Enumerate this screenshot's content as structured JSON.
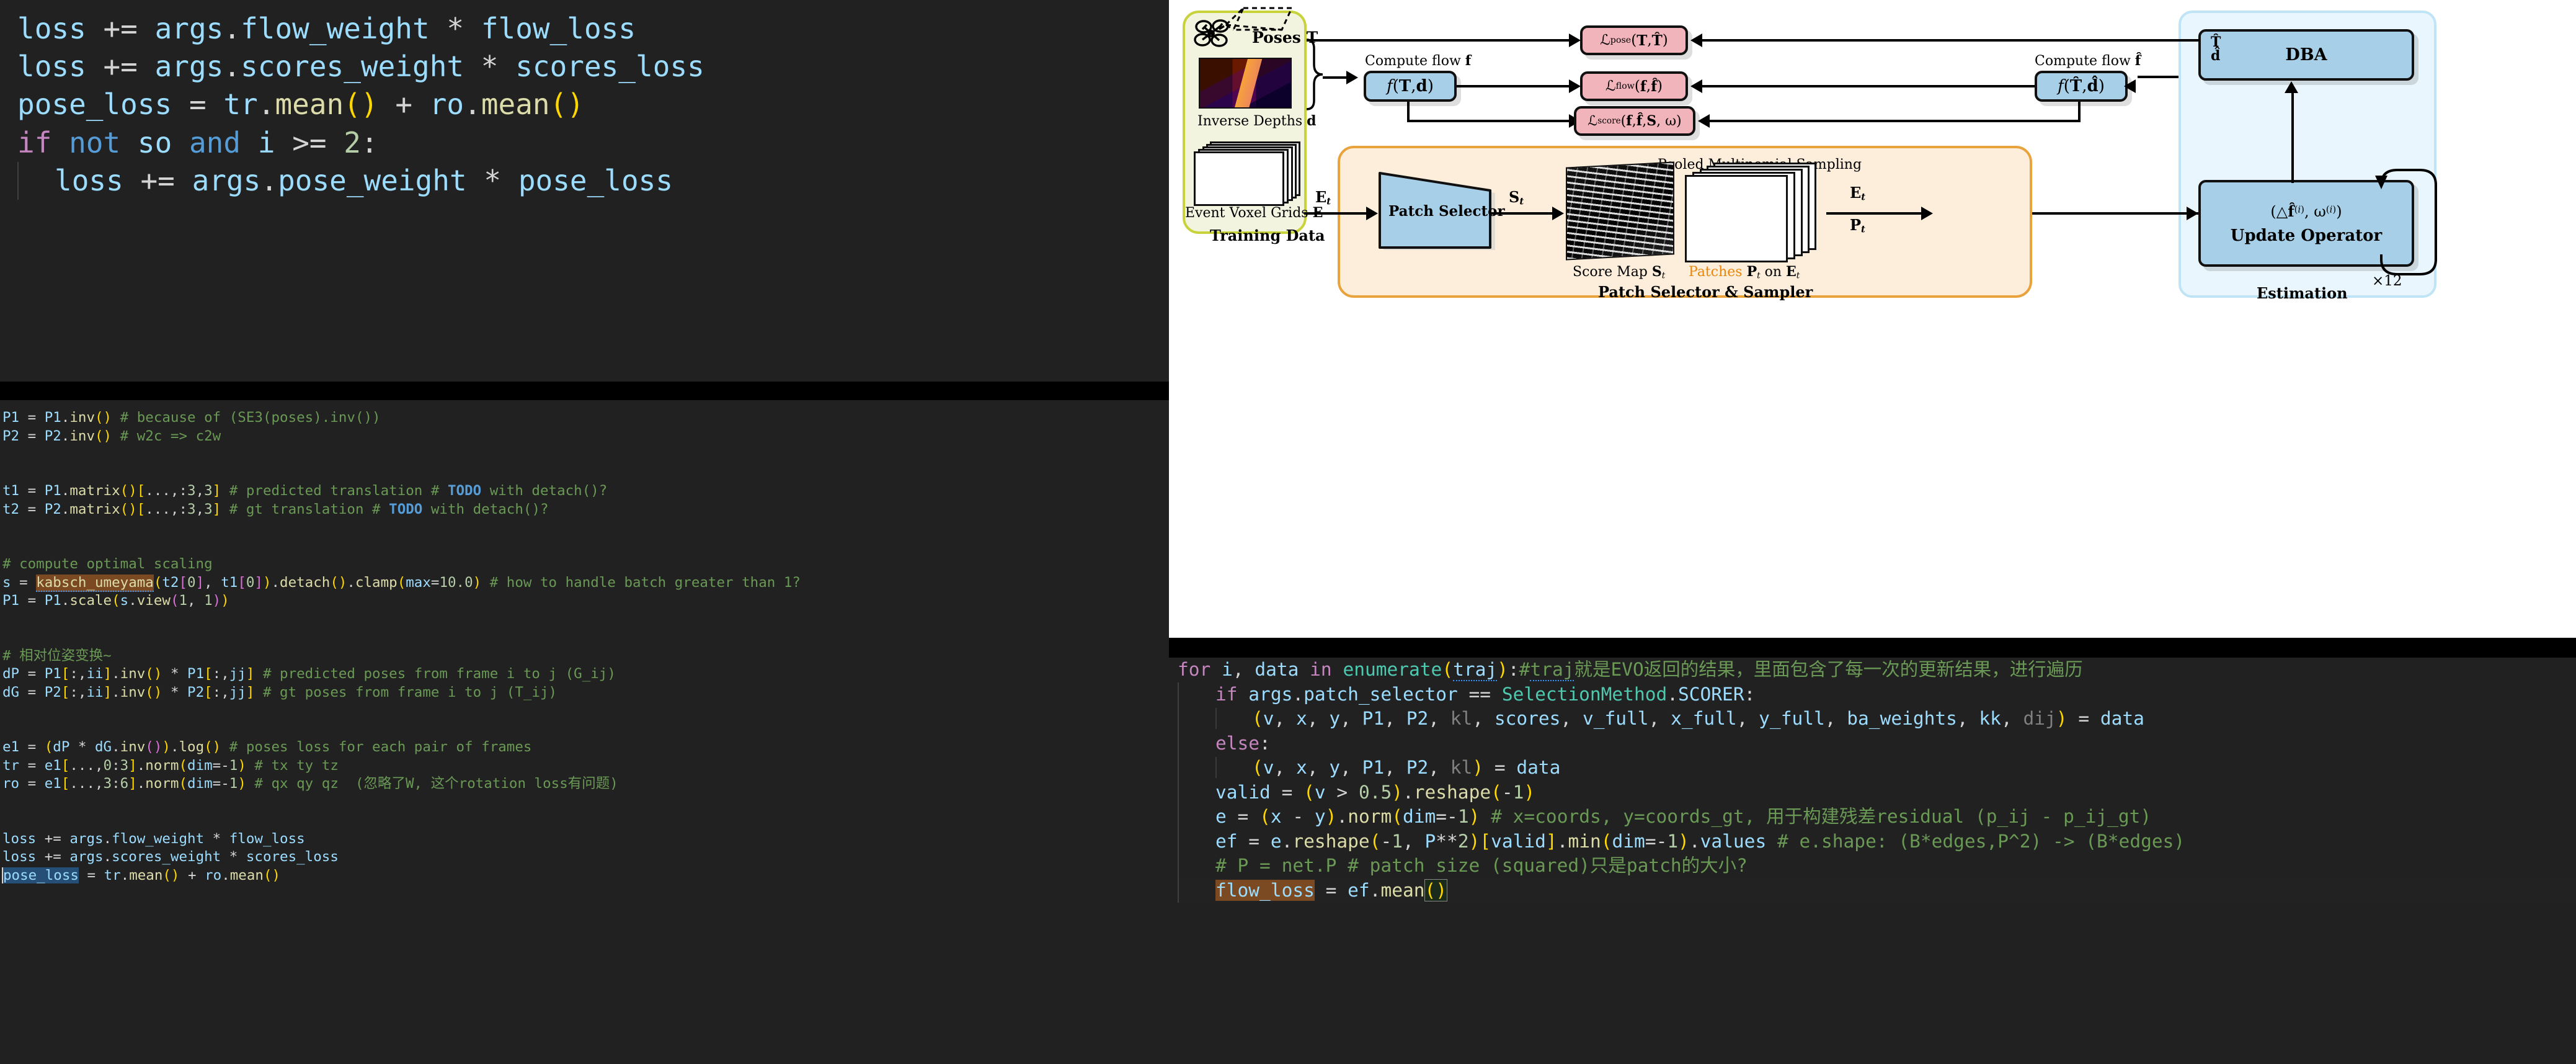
{
  "top_code_panel": {
    "name": "python-loss-snippet-large",
    "lines": [
      "loss += args.flow_weight * flow_loss",
      "loss += args.scores_weight * scores_loss",
      "pose_loss = tr.mean() + ro.mean()",
      "if not so and i >= 2:",
      "    loss += args.pose_weight * pose_loss"
    ]
  },
  "left_code_panel": {
    "name": "python-pose-loss-snippet",
    "lines": [
      "P1 = P1.inv() # because of (SE3(poses).inv())",
      "P2 = P2.inv() # w2c => c2w",
      "",
      "",
      "t1 = P1.matrix()[...,:3,3] # predicted translation # TODO with detach()?",
      "t2 = P2.matrix()[...,:3,3] # gt translation # TODO with detach()?",
      "",
      "",
      "# compute optimal scaling",
      "s = kabsch_umeyama(t2[0], t1[0]).detach().clamp(max=10.0) # how to handle batch greater than 1?",
      "P1 = P1.scale(s.view(1, 1))",
      "",
      "",
      "# 相对位姿变换~",
      "dP = P1[:,ii].inv() * P1[:,jj] # predicted poses from frame i to j (G_ij)",
      "dG = P2[:,ii].inv() * P2[:,jj] # gt poses from frame i to j (T_ij)",
      "",
      "",
      "e1 = (dP * dG.inv()).log() # poses loss for each pair of frames",
      "tr = e1[...,0:3].norm(dim=-1) # tx ty tz",
      "ro = e1[...,3:6].norm(dim=-1) # qx qy qz  (忽略了W, 这个rotation loss有问题)",
      "",
      "",
      "loss += args.flow_weight * flow_loss",
      "loss += args.scores_weight * scores_loss",
      "pose_loss = tr.mean() + ro.mean()"
    ],
    "highlighted_token": "kabsch_umeyama",
    "selected_token": "pose_loss"
  },
  "bottom_code_panel": {
    "name": "python-flow-loss-snippet",
    "lines": [
      "for i, data in enumerate(traj):#traj就是EVO返回的结果，里面包含了每一次的更新结果，进行遍历",
      "    if args.patch_selector == SelectionMethod.SCORER:",
      "        (v, x, y, P1, P2, kl, scores, v_full, x_full, y_full, ba_weights, kk, dij) = data",
      "    else:",
      "        (v, x, y, P1, P2, kl) = data",
      "    valid = (v > 0.5).reshape(-1)",
      "    e = (x - y).norm(dim=-1) # x=coords, y=coords_gt, 用于构建残差residual (p_ij - p_ij_gt)",
      "    ef = e.reshape(-1, P**2)[valid].min(dim=-1).values # e.shape: (B*edges,P^2) -> (B*edges)",
      "    # P = net.P # patch size (squared)只是patch的大小?",
      "    flow_loss = ef.mean()"
    ],
    "highlighted_token": "flow_loss"
  },
  "figure": {
    "groups": {
      "training_data": {
        "title": "Training Data",
        "border_color": "#c8d23a",
        "fill": "#f3f4e0"
      },
      "patch_selector": {
        "title": "Patch Selector & Sampler",
        "border_color": "#e8a33d",
        "fill": "#fdeedb"
      },
      "estimation": {
        "title": "Estimation",
        "border_color": "#bfe4f5",
        "fill": "#eaf6fd"
      }
    },
    "training_data": {
      "poses_label": "Poses T",
      "depth_caption": "Inverse Depths d",
      "events_caption": "Event Voxel Grids E",
      "drone_icon": "quadcopter-icon"
    },
    "compute_flow_gt": {
      "caption": "Compute flow f",
      "box": "f(T, d)"
    },
    "compute_flow_pred": {
      "caption": "Compute flow f̂",
      "box": "f(T̂, d̂)"
    },
    "losses": [
      {
        "name": "pose-loss",
        "label": "ℒpose(T, T̂)"
      },
      {
        "name": "flow-loss",
        "label": "ℒflow(f, f̂)"
      },
      {
        "name": "score-loss",
        "label": "ℒscore(f, f̂, S, ω)"
      }
    ],
    "patch_selector": {
      "node_label": "Patch Selector",
      "sampling_label": "Pooled Multinomial Sampling",
      "score_map_caption": "Score Map St",
      "patches_caption_accent": "Patches",
      "patches_caption_rest": "Pt on Et",
      "patches_accent_color": "#e8860c"
    },
    "estimation": {
      "dba_label": "DBA",
      "dba_inputs": "T̂ d̂",
      "update_operator_label": "Update Operator",
      "update_operator_signal": "(Δf̂(i), ω(i))",
      "loop_count": "×12"
    },
    "edge_labels": {
      "events_to_selector": "Et",
      "selector_to_scoremap": "St",
      "patches_to_update_1": "Et",
      "patches_to_update_2": "Pt"
    }
  }
}
